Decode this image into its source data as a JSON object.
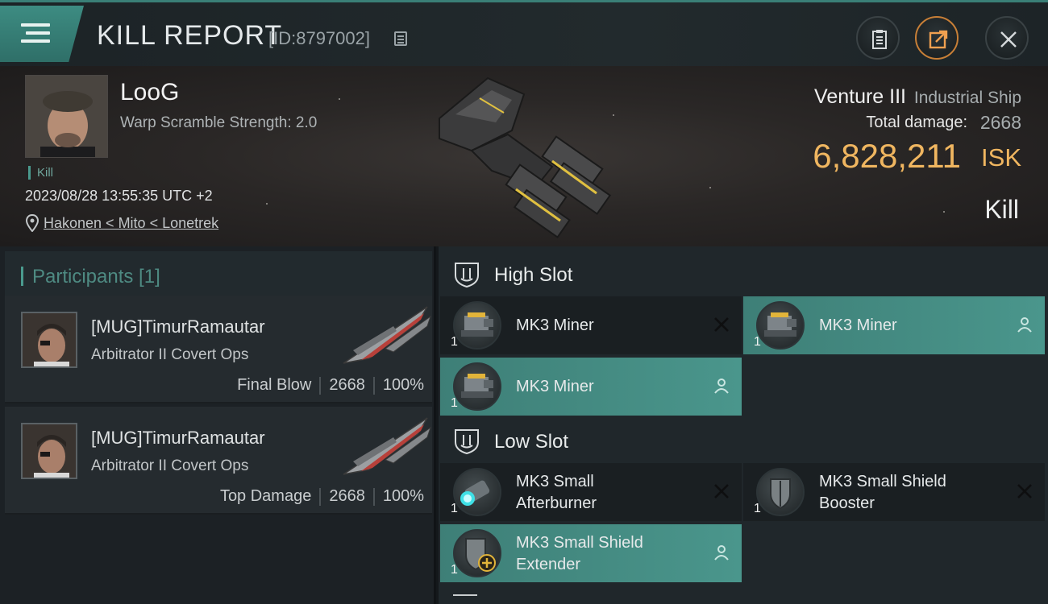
{
  "header": {
    "title": "KILL REPORT",
    "report_id": "[ID:8797002]",
    "accent_color": "#3d8c82"
  },
  "victim": {
    "name": "LooG",
    "warp_scramble": "Warp Scramble Strength: 2.0",
    "kill_tag": "Kill",
    "datetime": "2023/08/28 13:55:35 UTC +2",
    "location": "Hakonen < Mito < Lonetrek",
    "ship_name": "Venture III",
    "ship_class": "Industrial Ship",
    "total_damage_label": "Total damage:",
    "total_damage": "2668",
    "isk_value": "6,828,211",
    "isk_unit": "ISK",
    "result": "Kill",
    "isk_color": "#f0b660"
  },
  "participants": {
    "title": "Participants [1]",
    "items": [
      {
        "name": "[MUG]TimurRamautar",
        "ship": "Arbitrator II Covert Ops",
        "role": "Final Blow",
        "damage": "2668",
        "percent": "100%"
      },
      {
        "name": "[MUG]TimurRamautar",
        "ship": "Arbitrator II Covert Ops",
        "role": "Top Damage",
        "damage": "2668",
        "percent": "100%"
      }
    ]
  },
  "fitting": {
    "high_slot": {
      "title": "High Slot",
      "modules": [
        {
          "name": "MK3 Miner",
          "qty": "1",
          "status": "destroyed",
          "icon": "miner-icon"
        },
        {
          "name": "MK3 Miner",
          "qty": "1",
          "status": "dropped",
          "icon": "miner-icon"
        },
        {
          "name": "MK3 Miner",
          "qty": "1",
          "status": "dropped",
          "icon": "miner-icon"
        }
      ]
    },
    "low_slot": {
      "title": "Low Slot",
      "modules": [
        {
          "name_line1": "MK3 Small",
          "name_line2": "Afterburner",
          "qty": "1",
          "status": "destroyed",
          "icon": "afterburner-icon"
        },
        {
          "name_line1": "MK3 Small Shield",
          "name_line2": "Booster",
          "qty": "1",
          "status": "destroyed",
          "icon": "shield-booster-icon"
        },
        {
          "name_line1": "MK3 Small Shield",
          "name_line2": "Extender",
          "qty": "1",
          "status": "dropped",
          "icon": "shield-extender-icon"
        }
      ]
    }
  }
}
